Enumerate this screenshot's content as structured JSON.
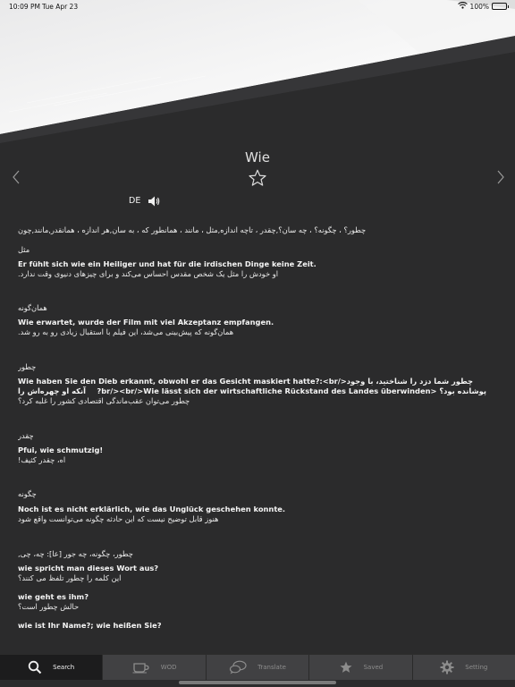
{
  "status": {
    "time": "10:09 PM",
    "date": "Tue Apr 23",
    "battery": "100%",
    "battery_level": 1.0
  },
  "word": {
    "title": "Wie",
    "language": "DE"
  },
  "content": {
    "meanings": "چطور؟ ، چگونه؟ ، چه سان؟,چقدر ، تاچه اندازه,مثل ، مانند ، همانطور که ، به سان,هر اندازه ، همانقدر,مانند,چون",
    "sections": [
      {
        "heading": "مثل",
        "de": "Er fühlt sich wie ein Heiliger und hat für die irdischen Dinge keine Zeit.",
        "fa": "او خودش را مثل یک شخص مقدس احساس می‌کند و برای چیزهای دنیوی وقت ندارد."
      },
      {
        "heading": "همان‌گونه",
        "de": "Wie erwartet, wurde der Film mit viel Akzeptanz empfangen.",
        "fa": "همان‌گونه که پیش‌بینی می‌شد، این فیلم با استقبال زیادی رو به رو شد."
      },
      {
        "heading": "چطور",
        "mixed1": "Wie haben Sie den Dieb erkannt, obwohl er das Gesicht maskiert hatte?:<br/>چطور شما دزد را شناختید، با وجود آنکه او چهره‌اش را",
        "mixed2": "پوشانده بود؟ <br/><br/>Wie lässt sich der wirtschaftliche Rückstand des Landes überwinden?",
        "fa": "چطور می‌توان عقب‌ماندگی اقتصادی کشور را غلبه کرد؟"
      },
      {
        "heading": "چقدر",
        "de": "Pfui, wie schmutzig!",
        "fa": "اه، چقدر کثیف!"
      },
      {
        "heading": "چگونه",
        "de": "Noch ist es nicht erklärlich, wie das Unglück geschehen konnte.",
        "fa": "هنوز قابل توضیح نیست که این حادثه چگونه می‌توانست واقع شود"
      }
    ],
    "extra_heading": "چطور، چگونه، چه جور [عا]: چه، چی,",
    "extra": [
      {
        "de": "wie spricht man dieses Wort aus?",
        "fa": "این کلمه را چطور تلفظ می کنند؟"
      },
      {
        "de": "wie geht es ihm?",
        "fa": "حالش چطور است؟"
      },
      {
        "de": "wie ist Ihr Name?; wie heißen Sie?",
        "fa": ""
      }
    ]
  },
  "tabs": [
    {
      "label": "Search",
      "icon": "search-icon"
    },
    {
      "label": "WOD",
      "icon": "cup-icon"
    },
    {
      "label": "Translate",
      "icon": "chat-bubbles-icon"
    },
    {
      "label": "Saved",
      "icon": "star-icon"
    },
    {
      "label": "Setting",
      "icon": "gear-icon"
    }
  ],
  "colors": {
    "background": "#2b2b2c",
    "tabbar": "#414143",
    "tab_active": "#1c1c1d"
  }
}
